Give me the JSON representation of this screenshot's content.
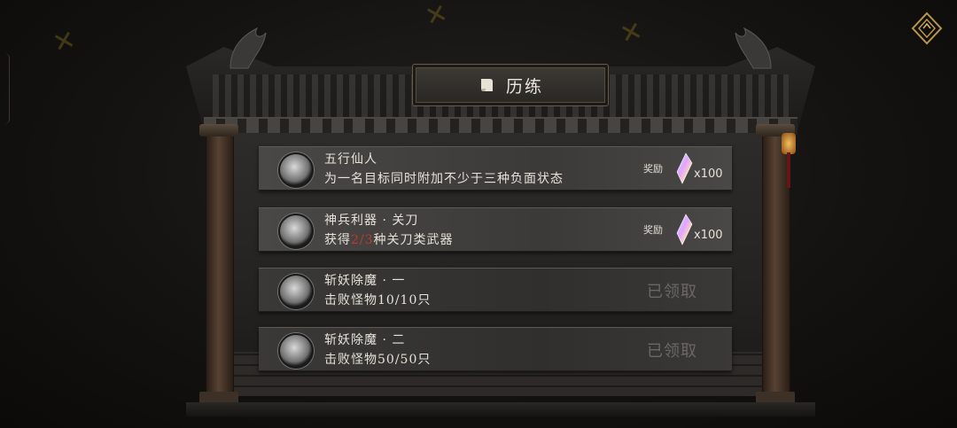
{
  "header": {
    "title": "历练",
    "scroll_icon": "scroll-icon"
  },
  "corner_button": {
    "icon": "diamond-back-icon"
  },
  "tasks": [
    {
      "name": "五行仙人",
      "desc_before": "为一名目标同时附加不少于三种负面状态",
      "progress": "",
      "desc_after": "",
      "reward_label": "奖励",
      "reward_count": "x100",
      "claimed": ""
    },
    {
      "name": "神兵利器 · 关刀",
      "desc_before": "获得",
      "progress": "2/3",
      "desc_after": "种关刀类武器",
      "reward_label": "奖励",
      "reward_count": "x100",
      "claimed": ""
    },
    {
      "name": "斩妖除魔 · 一",
      "desc_before": "击败怪物10/10只",
      "progress": "",
      "desc_after": "",
      "reward_label": "",
      "reward_count": "",
      "claimed": "已领取"
    },
    {
      "name": "斩妖除魔 · 二",
      "desc_before": "击败怪物50/50只",
      "progress": "",
      "desc_after": "",
      "reward_label": "",
      "reward_count": "",
      "claimed": "已领取"
    }
  ],
  "colors": {
    "progress_highlight": "#c0392b",
    "claimed_text": "#6a6764"
  }
}
